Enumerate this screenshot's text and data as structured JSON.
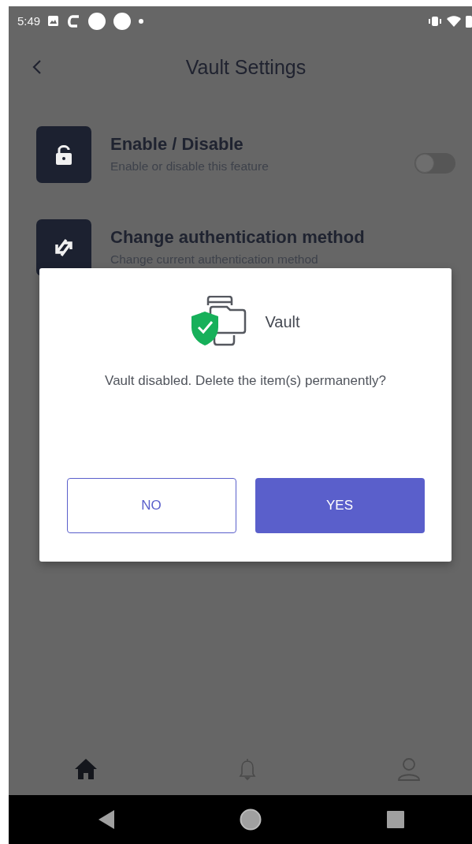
{
  "status_bar": {
    "time": "5:49"
  },
  "header": {
    "title": "Vault Settings"
  },
  "settings": [
    {
      "kind": "toggle",
      "title": "Enable / Disable",
      "subtitle": "Enable or disable this feature",
      "on": false
    },
    {
      "kind": "link",
      "title": "Change authentication method",
      "subtitle": "Change current authentication method"
    }
  ],
  "dialog": {
    "app_name": "Vault",
    "message": "Vault disabled. Delete the item(s) permanently?",
    "buttons": [
      {
        "label": "NO",
        "kind": "outlined"
      },
      {
        "label": "YES",
        "kind": "filled"
      }
    ]
  },
  "bottom_nav": [
    {
      "kind": "home",
      "selected": true
    },
    {
      "kind": "bell",
      "selected": false
    },
    {
      "kind": "person",
      "selected": false
    }
  ]
}
